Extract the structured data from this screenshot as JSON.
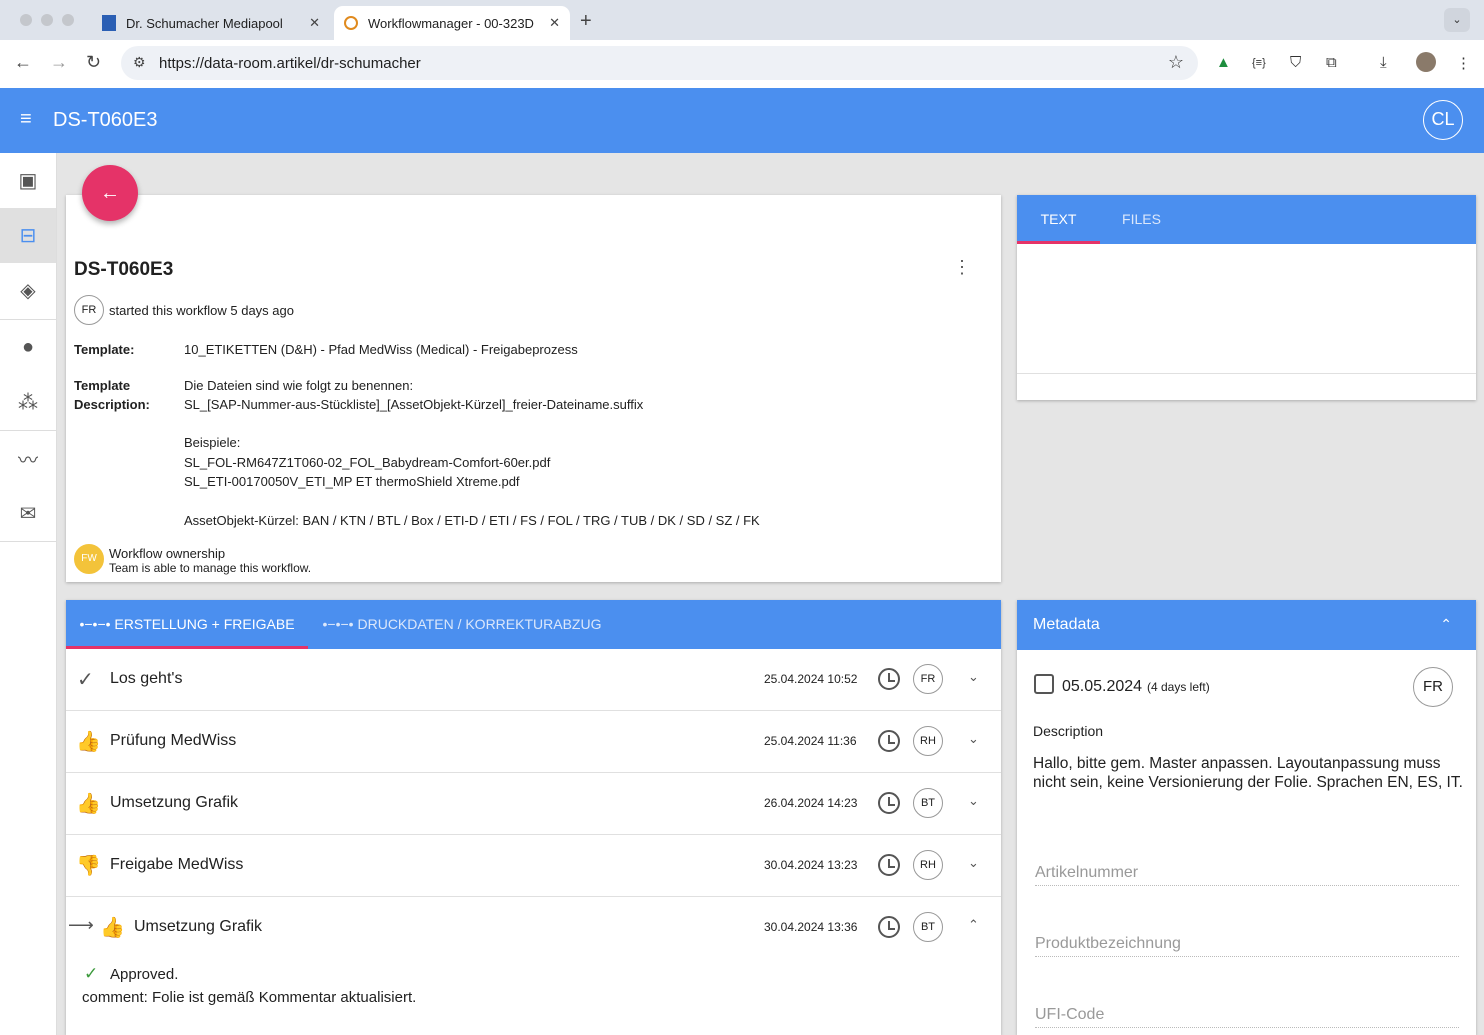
{
  "browser": {
    "tabs": [
      {
        "title": "Dr. Schumacher Mediapool"
      },
      {
        "title": "Workflowmanager - 00-323D"
      }
    ],
    "url": "https://data-room.artikel/dr-schumacher"
  },
  "app": {
    "title": "DS-T060E3",
    "user_initials": "CL"
  },
  "workflow": {
    "title": "DS-T060E3",
    "starter_initials": "FR",
    "started_text": "started this workflow 5 days ago",
    "template_label": "Template:",
    "template_value": "10_ETIKETTEN (D&H) - Pfad MedWiss (Medical) - Freigabeprozess",
    "description_label_1": "Template",
    "description_label_2": "Description:",
    "description_lines": [
      "Die Dateien sind wie folgt zu benennen:",
      "SL_[SAP-Nummer-aus-Stückliste]_[AssetObjekt-Kürzel]_freier-Dateiname.suffix",
      "Beispiele:",
      "SL_FOL-RM647Z1T060-02_FOL_Babydream-Comfort-60er.pdf",
      "SL_ETI-00170050V_ETI_MP ET thermoShield Xtreme.pdf",
      "AssetObjekt-Kürzel: BAN / KTN / BTL / Box / ETI-D / ETI / FS / FOL / TRG / TUB / DK / SD / SZ / FK"
    ],
    "ownership_initials": "FW",
    "ownership_title": "Workflow ownership",
    "ownership_text": "Team is able to manage this workflow."
  },
  "text_card": {
    "tabs": [
      "TEXT",
      "FILES"
    ]
  },
  "steps_card": {
    "tabs": [
      "ERSTELLUNG + FREIGABE",
      "DRUCKDATEN / KORREKTURABZUG"
    ],
    "steps": [
      {
        "icon": "check",
        "name": "Los geht's",
        "date": "25.04.2024 10:52",
        "who": "FR"
      },
      {
        "icon": "thumb-up",
        "name": "Prüfung MedWiss",
        "date": "25.04.2024 11:36",
        "who": "RH"
      },
      {
        "icon": "thumb-up",
        "name": "Umsetzung Grafik",
        "date": "26.04.2024 14:23",
        "who": "BT"
      },
      {
        "icon": "thumb-down",
        "name": "Freigabe MedWiss",
        "date": "30.04.2024 13:23",
        "who": "RH"
      },
      {
        "icon": "thumb-up",
        "name": "Umsetzung Grafik",
        "date": "30.04.2024 13:36",
        "who": "BT"
      }
    ],
    "approved_text": "Approved.",
    "comment_text": "comment: Folie ist gemäß Kommentar aktualisiert."
  },
  "metadata": {
    "title": "Metadata",
    "due_date": "05.05.2024",
    "days_left": "(4 days left)",
    "assignee": "FR",
    "description_label": "Description",
    "description": "Hallo, bitte gem. Master anpassen. Layoutanpassung muss nicht sein, keine Versionierung der Folie. Sprachen EN, ES, IT.",
    "fields": [
      "Artikelnummer",
      "Produktbezeichnung",
      "UFI-Code"
    ]
  },
  "colors": {
    "primary": "#4b8fef",
    "accent": "#e53368",
    "owner_badge": "#f3c33a"
  }
}
